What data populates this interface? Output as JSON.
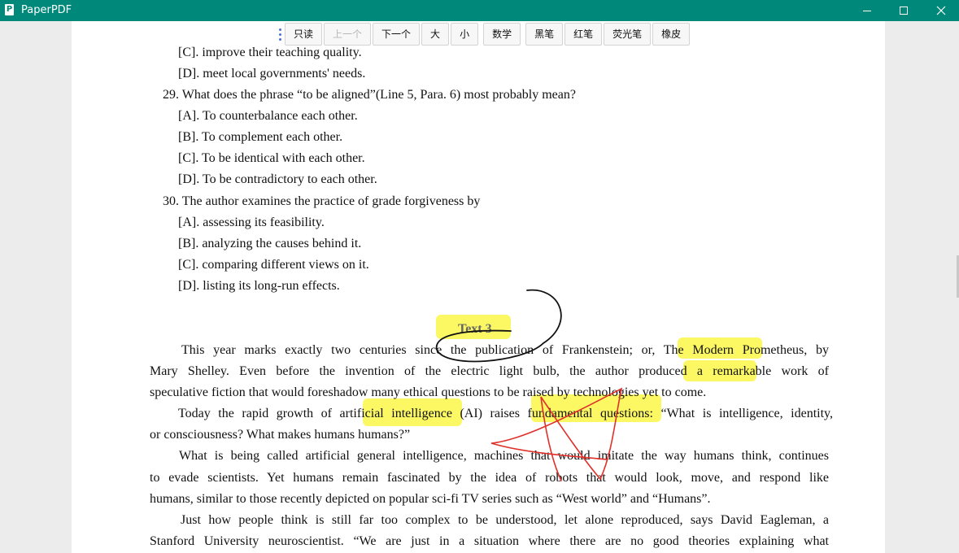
{
  "window": {
    "title": "PaperPDF",
    "app_icon_glyph": "P",
    "controls": [
      "minimize-icon",
      "maximize-icon",
      "close-icon"
    ]
  },
  "toolbar": {
    "readonly": "只读",
    "prev": "上一个",
    "next": "下一个",
    "zoom_in": "大",
    "zoom_out": "小",
    "math": "数学",
    "black_pen": "黑笔",
    "red_pen": "红笔",
    "highlighter": "荧光笔",
    "eraser": "橡皮"
  },
  "doc": {
    "q28_c": "[C]. improve their teaching quality.",
    "q28_d": "[D]. meet local governments' needs.",
    "q29": "29. What does the phrase “to be aligned”(Line 5, Para. 6) most probably mean?",
    "q29_a": "[A]. To counterbalance each other.",
    "q29_b": "[B]. To complement each other.",
    "q29_c": "[C]. To be identical with each other.",
    "q29_d": "[D]. To be contradictory to each other.",
    "q30": "30. The author examines the practice of grade forgiveness by",
    "q30_a": "[A]. assessing its feasibility.",
    "q30_b": "[B]. analyzing the causes behind it.",
    "q30_c": "[C]. comparing different views on it.",
    "q30_d": "[D]. listing its long-run effects.",
    "text_heading": "Text 3",
    "p1_l1": "This year marks exactly two centuries since the publication of Frankenstein; or, The Modern Prometheus, by",
    "p1_l2": "Mary Shelley. Even before the invention of the electric light bulb, the author produced a remarkable work of",
    "p1_l3": "speculative fiction that would foreshadow many ethical questions to be raised by technologies yet to come.",
    "p2_l1": "Today the rapid growth of artificial intelligence (AI) raises fundamental questions: “What is intelligence, identity,",
    "p2_l2": "or consciousness? What makes humans humans?”",
    "p3_l1": "What is being called artificial general intelligence, machines that would imitate the way humans think, continues",
    "p3_l2": "to evade scientists. Yet humans remain fascinated by the idea of robots that would look, move, and respond like",
    "p3_l3": "humans, similar to those recently depicted on popular sci-fi TV series such as “West world” and “Humans”.",
    "p4_l1": "Just how people think is still far too complex to be understood, let alone reproduced, says David Eagleman, a",
    "p4_l2": "Stanford University neuroscientist. “We are just in a situation where there are no good theories explaining what"
  },
  "annotations": {
    "highlight_color": "#faf528",
    "black_ink_color": "#111111",
    "red_ink_color": "#e0302a"
  }
}
